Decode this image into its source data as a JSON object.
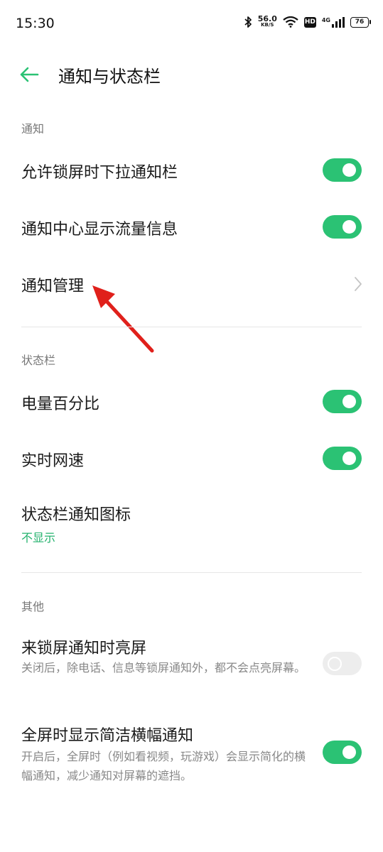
{
  "status_bar": {
    "time": "15:30",
    "speed_value": "56.0",
    "speed_unit": "KB/S",
    "hd": "HD",
    "network": "4G",
    "battery": "76"
  },
  "header": {
    "title": "通知与状态栏"
  },
  "sections": {
    "notify": {
      "label": "通知",
      "lockscreen_pull": "允许锁屏时下拉通知栏",
      "traffic_info": "通知中心显示流量信息",
      "manage": "通知管理"
    },
    "statusbar": {
      "label": "状态栏",
      "battery_pct": "电量百分比",
      "net_speed": "实时网速",
      "notify_icon": "状态栏通知图标",
      "notify_icon_value": "不显示"
    },
    "other": {
      "label": "其他",
      "wake_screen": "来锁屏通知时亮屏",
      "wake_screen_desc": "关闭后，除电话、信息等锁屏通知外，都不会点亮屏幕。",
      "banner": "全屏时显示简洁横幅通知",
      "banner_desc": "开启后，全屏时（例如看视频，玩游戏）会显示简化的横幅通知，减少通知对屏幕的遮挡。"
    }
  },
  "toggles": {
    "lockscreen_pull": true,
    "traffic_info": true,
    "battery_pct": true,
    "net_speed": true,
    "wake_screen": false,
    "banner": true
  },
  "colors": {
    "accent": "#2bc274",
    "annotation_arrow": "#e0201b"
  },
  "icons": {
    "back": "back-arrow-icon",
    "chevron": "chevron-right-icon",
    "annotation": "red-arrow-annotation"
  }
}
